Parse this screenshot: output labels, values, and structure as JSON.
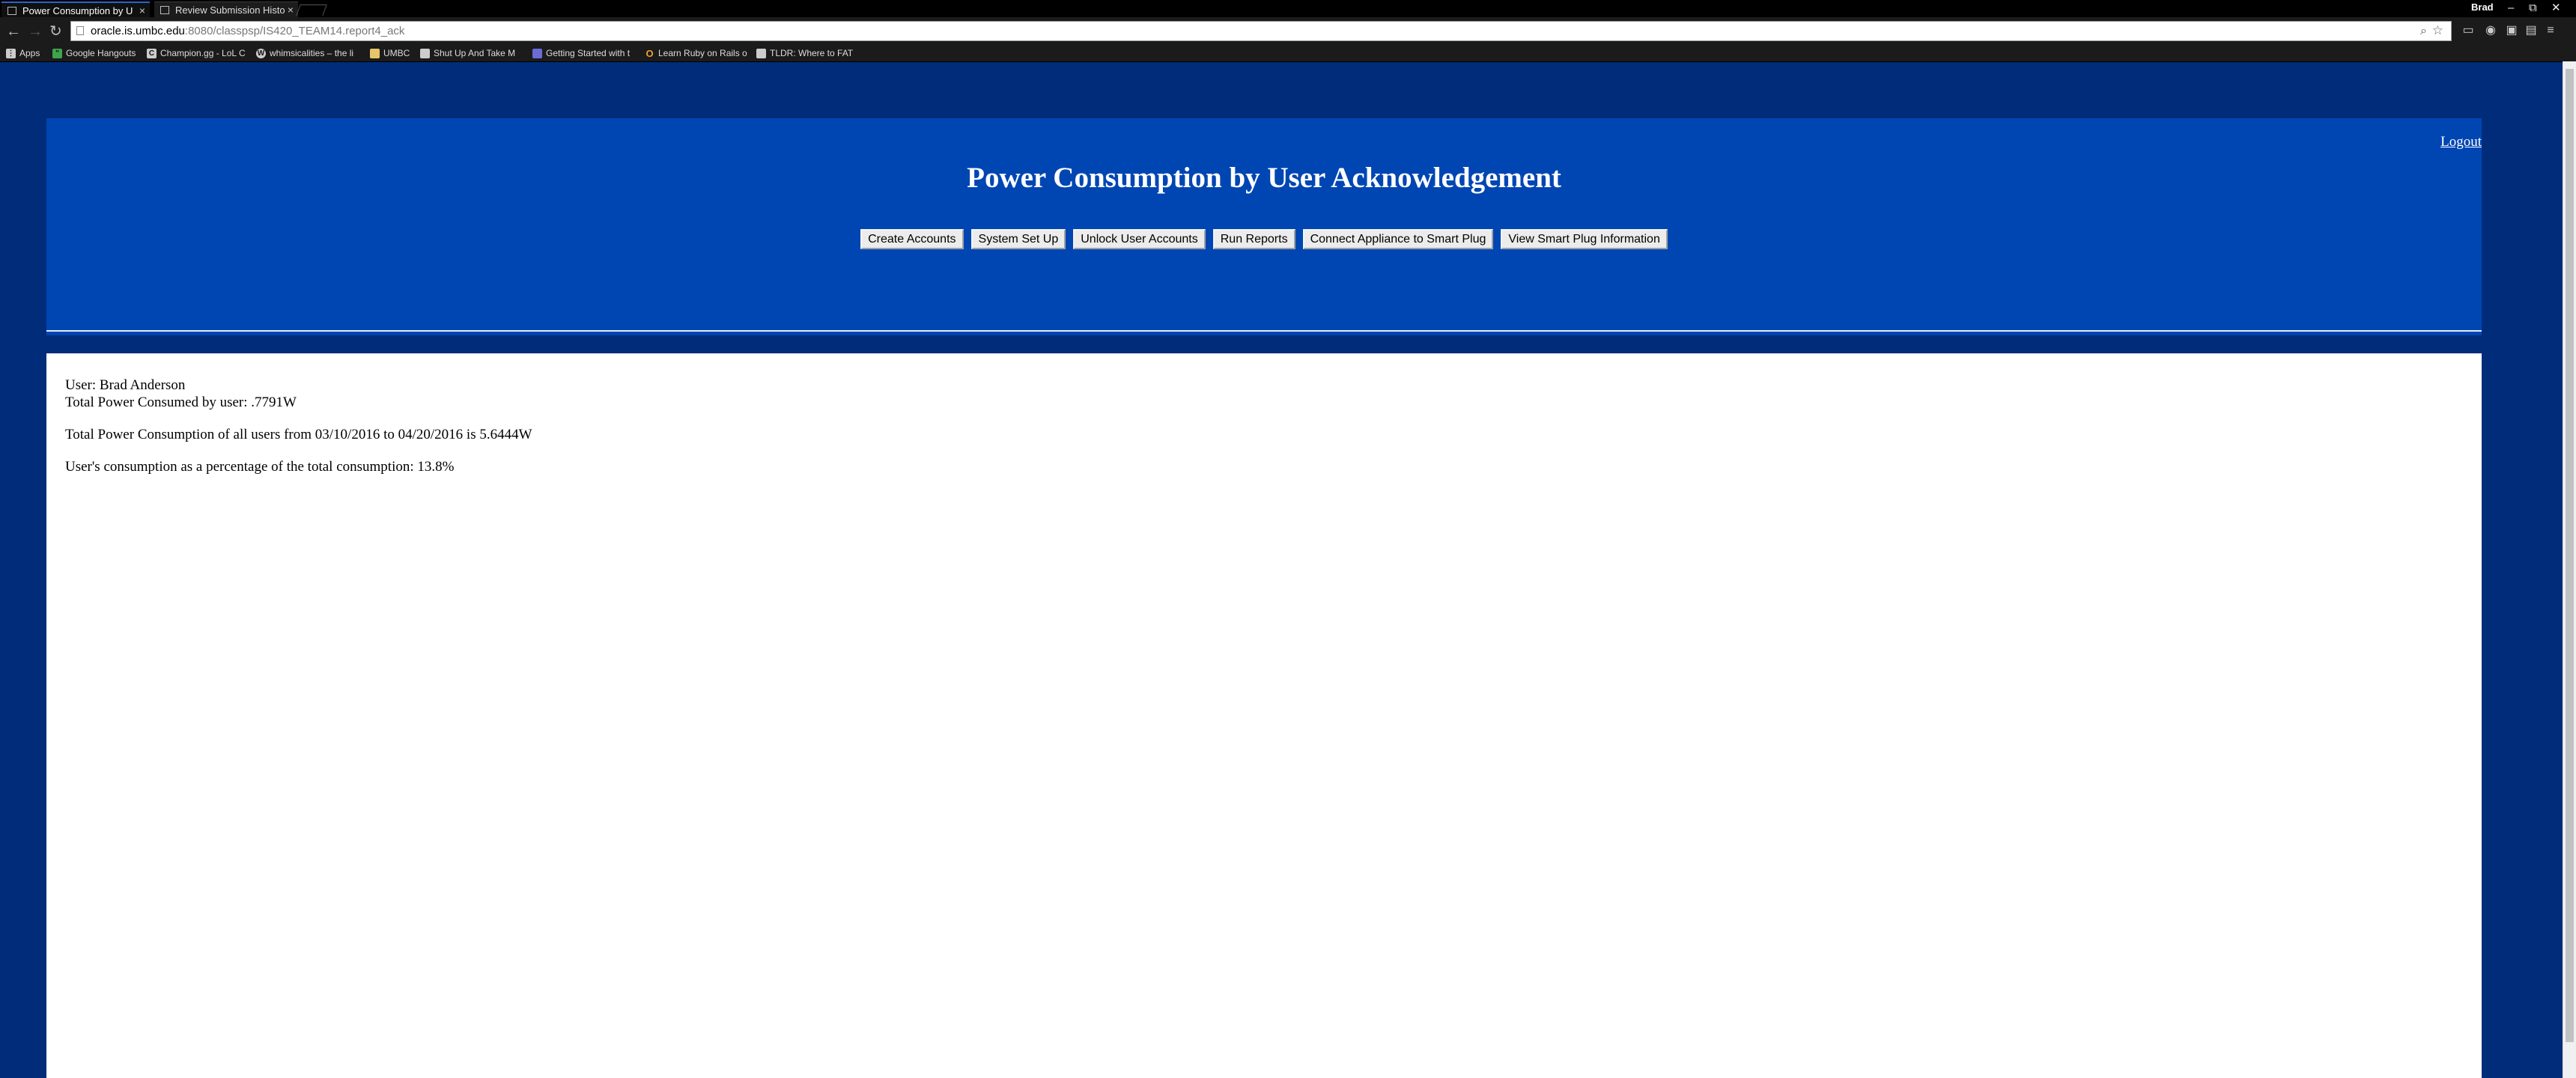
{
  "browser": {
    "tabs": [
      {
        "title": "Power Consumption by U",
        "active": true
      },
      {
        "title": "Review Submission Histo",
        "active": false
      }
    ],
    "profile": "Brad",
    "url_host": "oracle.is.umbc.edu",
    "url_path": ":8080/classpsp/IS420_TEAM14.report4_ack",
    "bookmarks": [
      {
        "label": "Apps",
        "icon": "apps-grid-icon"
      },
      {
        "label": "Google Hangouts",
        "icon": "hangouts-icon"
      },
      {
        "label": "Champion.gg - LoL C",
        "icon": "champion-icon"
      },
      {
        "label": "whimsicalities – the li",
        "icon": "wordpress-icon"
      },
      {
        "label": "UMBC",
        "icon": "folder-icon"
      },
      {
        "label": "Shut Up And Take M",
        "icon": "page-icon"
      },
      {
        "label": "Getting Started with t",
        "icon": "bookmark-icon"
      },
      {
        "label": "Learn Ruby on Rails o",
        "icon": "ruby-icon"
      },
      {
        "label": "TLDR: Where to FAT",
        "icon": "image-icon"
      }
    ]
  },
  "page": {
    "logout": "Logout",
    "title": "Power Consumption by User Acknowledgement",
    "nav": [
      "Create Accounts",
      "System Set Up",
      "Unlock User Accounts",
      "Run Reports",
      "Connect Appliance to Smart Plug",
      "View Smart Plug Information"
    ],
    "user_line": "User: Brad Anderson",
    "user_total_line": "Total Power Consumed by user: .7791W",
    "all_users_line": "Total Power Consumption of all users from 03/10/2016 to 04/20/2016 is 5.6444W",
    "percentage_line": "User's consumption as a percentage of the total consumption: 13.8%"
  },
  "colors": {
    "background": "#002c7a",
    "header": "#0046b3",
    "content": "#ffffff"
  }
}
